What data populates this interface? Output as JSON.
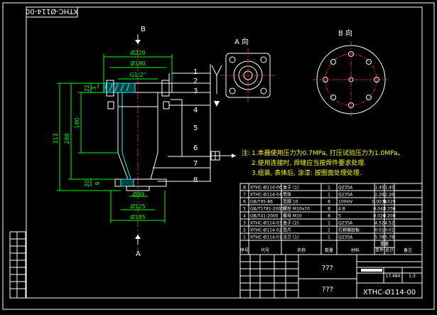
{
  "drawing": {
    "code_rotated": "XTHC-Ø114-00",
    "code_titleblock": "XTHC-Ø114-00",
    "title_a": "???",
    "title_b": "???",
    "scale": "1:3",
    "weight": "17.484"
  },
  "views": {
    "a_label": "A 向",
    "b_label": "B 向",
    "section_top": "B",
    "section_bottom": "A",
    "section_left_a": "A"
  },
  "dimensions": {
    "d220": "Ø220",
    "d180": "Ø180",
    "g12": "G1/2\"",
    "d99": "Ø99",
    "d125": "Ø125",
    "d185": "Ø185",
    "h313": "313",
    "h288": "288",
    "h180": "180",
    "h22": "22",
    "h3": "3",
    "h20": "20",
    "h9": "9"
  },
  "balloons": [
    "1",
    "2",
    "3",
    "4",
    "5",
    "6",
    "7",
    "8"
  ],
  "notes": {
    "prefix": "注:",
    "n1": "1.本器使用压力为0.7MPa, 打压试验压力为1.0MPa。",
    "n2": "2.使用连接时, 焊缝应当按焊件要求处理.",
    "n3": "3.组装, 表体后, 涂漆: 按图面处理处理."
  },
  "bom": {
    "rows": [
      {
        "no": "8",
        "code": "XTHC-Ø114-06",
        "name": "盖子 (1)",
        "qty": "1",
        "mat": "Q235A",
        "w1": "1.45",
        "w2": "1.45"
      },
      {
        "no": "7",
        "code": "XTHC-Ø114-04",
        "name": "筒体",
        "qty": "1",
        "mat": "Q235A",
        "w1": "2.26",
        "w2": "2.26"
      },
      {
        "no": "6",
        "code": "GB/T95-86",
        "name": "垫圈 10",
        "qty": "8",
        "mat": "100HV",
        "w1": "0.0036",
        "w2": "0.029"
      },
      {
        "no": "5",
        "code": "GB/T5781-2000",
        "name": "螺栓 M10x70",
        "qty": "8",
        "mat": "4.8",
        "w1": "0.042",
        "w2": "0.336"
      },
      {
        "no": "4",
        "code": "GB/T41-2000",
        "name": "螺母 M10",
        "qty": "8",
        "mat": "5",
        "w1": "0.026",
        "w2": "0.208"
      },
      {
        "no": "3",
        "code": "XTHC-Ø114-03",
        "name": "盖子 (2)",
        "qty": "1",
        "mat": "Q235A",
        "w1": "4.52",
        "w2": "4.52"
      },
      {
        "no": "2",
        "code": "XTHC-Ø114-02",
        "name": "垫片",
        "qty": "1",
        "mat": "石棉橡胶板",
        "w1": "0.01",
        "w2": "0.01"
      },
      {
        "no": "1",
        "code": "XTHC-Ø114-01",
        "name": "法兰 (1)",
        "qty": "1",
        "mat": "Q235A",
        "w1": "5.78",
        "w2": "5.78"
      }
    ],
    "header": {
      "no": "序号",
      "code": "代号",
      "name": "名称",
      "qty": "数量",
      "mat": "材料",
      "w1": "单件",
      "w2": "总计",
      "weight": "重量",
      "note": "备注"
    }
  }
}
